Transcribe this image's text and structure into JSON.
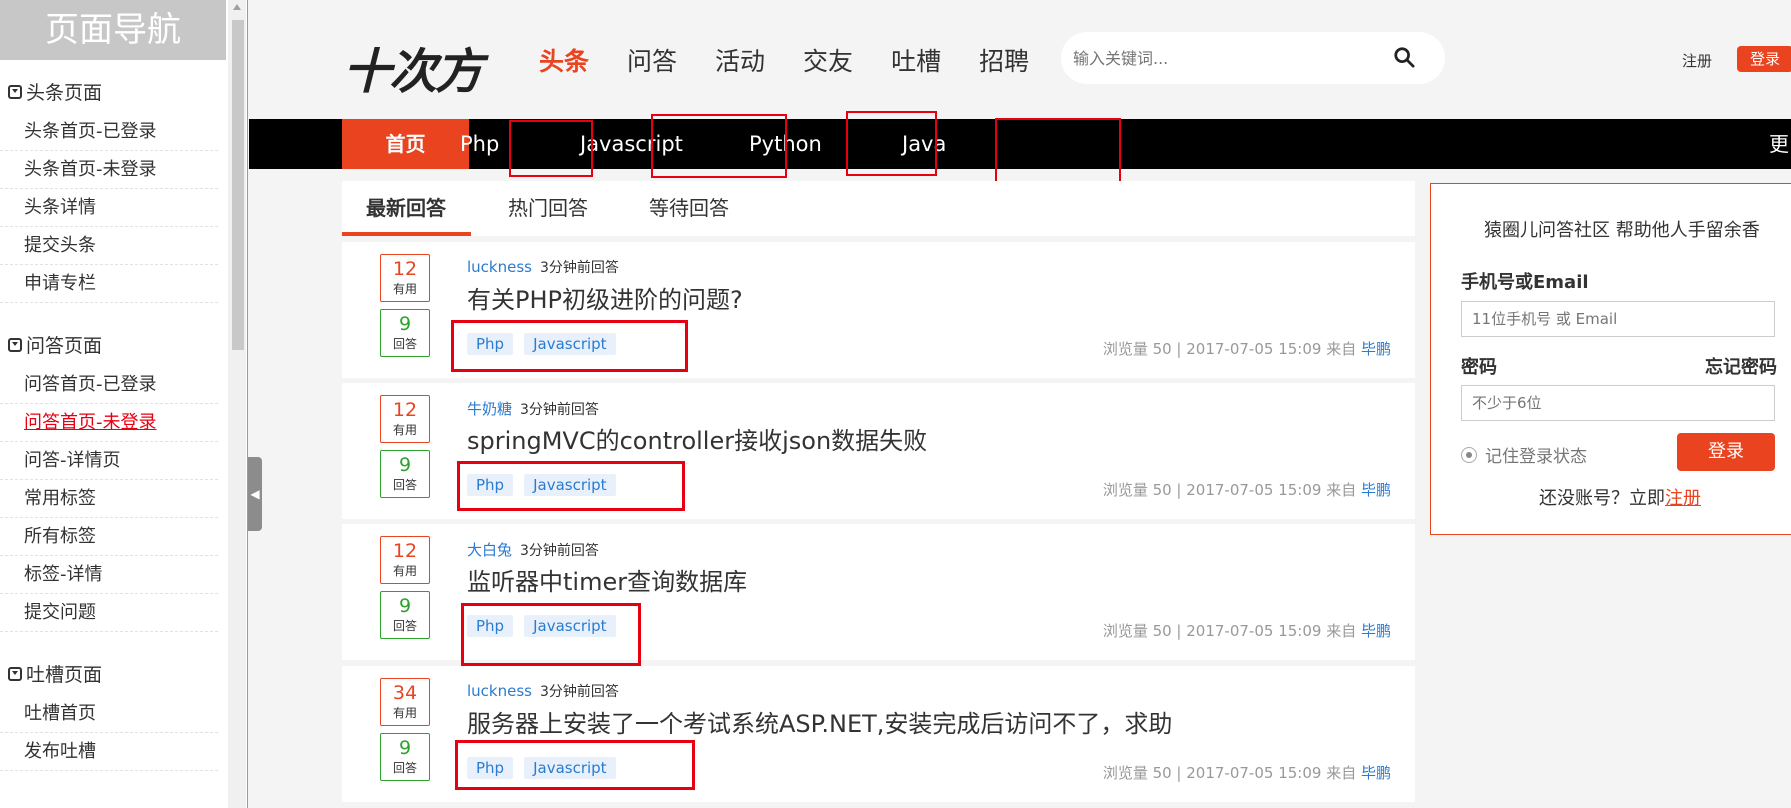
{
  "leftnav": {
    "title": "页面导航",
    "groups": [
      {
        "title": "头条页面",
        "items": [
          "头条首页-已登录",
          "头条首页-未登录",
          "头条详情",
          "提交头条",
          "申请专栏"
        ]
      },
      {
        "title": "问答页面",
        "items": [
          "问答首页-已登录",
          "问答首页-未登录",
          "问答-详情页",
          "常用标签",
          "所有标签",
          "标签-详情",
          "提交问题"
        ]
      },
      {
        "title": "吐槽页面",
        "items": [
          "吐槽首页",
          "发布吐槽"
        ]
      }
    ],
    "active_item": "问答首页-未登录"
  },
  "header": {
    "logo": "十次方",
    "nav": [
      "头条",
      "问答",
      "活动",
      "交友",
      "吐槽",
      "招聘"
    ],
    "active_nav": "头条",
    "search_placeholder": "输入关键词...",
    "register": "注册",
    "login": "登录"
  },
  "catbar": {
    "home": "首页",
    "items": [
      "Php",
      "Javascript",
      "Python",
      "Java"
    ],
    "more": "更多"
  },
  "tabs": [
    "最新回答",
    "热门回答",
    "等待回答"
  ],
  "questions": [
    {
      "useful": "12",
      "useful_label": "有用",
      "answers": "9",
      "answers_label": "回答",
      "author": "luckness",
      "time": "3分钟前回答",
      "title": "有关PHP初级进阶的问题?",
      "tags": [
        "Php",
        "Javascript"
      ],
      "meta": "浏览量 50 | 2017-07-05 15:09 来自",
      "source": "毕鹏"
    },
    {
      "useful": "12",
      "useful_label": "有用",
      "answers": "9",
      "answers_label": "回答",
      "author": "牛奶糖",
      "time": "3分钟前回答",
      "title": "springMVC的controller接收json数据失败",
      "tags": [
        "Php",
        "Javascript"
      ],
      "meta": "浏览量 50 | 2017-07-05 15:09 来自",
      "source": "毕鹏"
    },
    {
      "useful": "12",
      "useful_label": "有用",
      "answers": "9",
      "answers_label": "回答",
      "author": "大白兔",
      "time": "3分钟前回答",
      "title": "监听器中timer查询数据库",
      "tags": [
        "Php",
        "Javascript"
      ],
      "meta": "浏览量 50 | 2017-07-05 15:09 来自",
      "source": "毕鹏"
    },
    {
      "useful": "34",
      "useful_label": "有用",
      "answers": "9",
      "answers_label": "回答",
      "author": "luckness",
      "time": "3分钟前回答",
      "title": "服务器上安装了一个考试系统ASP.NET,安装完成后访问不了，求助",
      "tags": [
        "Php",
        "Javascript"
      ],
      "meta": "浏览量 50 | 2017-07-05 15:09 来自",
      "source": "毕鹏"
    }
  ],
  "login_panel": {
    "slogan": "猿圈儿问答社区 帮助他人手留余香",
    "account_label": "手机号或Email",
    "account_placeholder": "11位手机号 或 Email",
    "password_label": "密码",
    "forgot": "忘记密码",
    "password_placeholder": "不少于6位",
    "remember": "记住登录状态",
    "login_button": "登录",
    "no_account": "还没账号？立即",
    "register_link": "注册"
  },
  "colors": {
    "brand": "#e9431f",
    "highlight": "#e60012",
    "link": "#2a7bd1",
    "answers": "#2ba22b"
  }
}
